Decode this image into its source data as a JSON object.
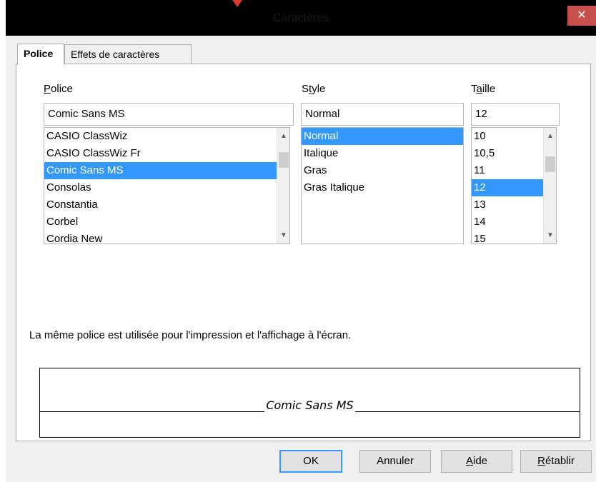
{
  "window": {
    "title": "Caractères",
    "close_glyph": "✕"
  },
  "tabs": [
    {
      "label": "Police",
      "active": true
    },
    {
      "label": "Effets de caractères",
      "active": false
    }
  ],
  "font": {
    "label": "Police",
    "value": "Comic Sans MS",
    "options": [
      "CASIO ClassWiz",
      "CASIO ClassWiz Fr",
      "Comic Sans MS",
      "Consolas",
      "Constantia",
      "Corbel",
      "Cordia New"
    ],
    "selected_index": 2
  },
  "style": {
    "label": "Style",
    "value": "Normal",
    "options": [
      "Normal",
      "Italique",
      "Gras",
      "Gras Italique"
    ],
    "selected_index": 0
  },
  "size": {
    "label": "Taille",
    "value": "12",
    "options": [
      "10",
      "10,5",
      "11",
      "12",
      "13",
      "14",
      "15"
    ],
    "selected_index": 3
  },
  "info_text": "La même police est utilisée pour l'impression et l'affichage à l'écran.",
  "preview": {
    "text": "Comic Sans MS"
  },
  "buttons": {
    "ok": "OK",
    "cancel": "Annuler",
    "help": "Aide",
    "reset": "Rétablir"
  },
  "colors": {
    "selection": "#3399ff",
    "close_button": "#c7504d",
    "titlebar": "#000000"
  }
}
